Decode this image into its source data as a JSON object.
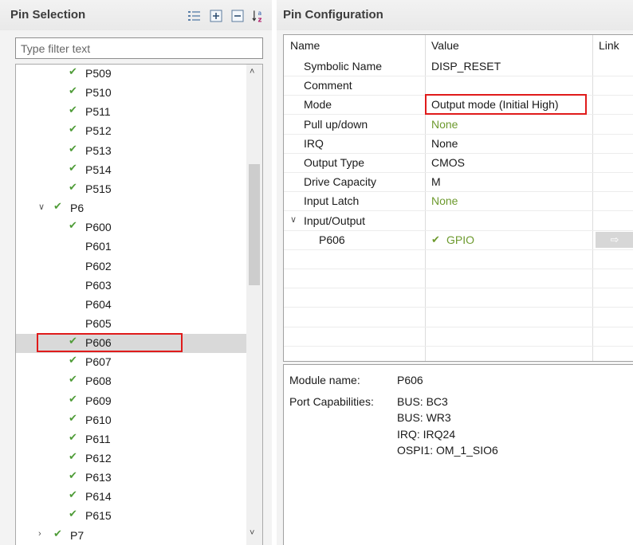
{
  "pin_selection": {
    "title": "Pin Selection",
    "toolbar": [
      {
        "icon": "tree-view-icon"
      },
      {
        "icon": "expand-all-icon"
      },
      {
        "icon": "collapse-all-icon"
      },
      {
        "icon": "sort-az-icon"
      }
    ],
    "filter": {
      "placeholder": "Type filter text",
      "value": ""
    },
    "items": [
      {
        "label": "P509",
        "checked": true,
        "level": 1
      },
      {
        "label": "P510",
        "checked": true,
        "level": 1
      },
      {
        "label": "P511",
        "checked": true,
        "level": 1
      },
      {
        "label": "P512",
        "checked": true,
        "level": 1
      },
      {
        "label": "P513",
        "checked": true,
        "level": 1
      },
      {
        "label": "P514",
        "checked": true,
        "level": 1
      },
      {
        "label": "P515",
        "checked": true,
        "level": 1
      },
      {
        "label": "P6",
        "checked": true,
        "level": 0,
        "expanded": true
      },
      {
        "label": "P600",
        "checked": true,
        "level": 1
      },
      {
        "label": "P601",
        "checked": false,
        "level": 1
      },
      {
        "label": "P602",
        "checked": false,
        "level": 1
      },
      {
        "label": "P603",
        "checked": false,
        "level": 1
      },
      {
        "label": "P604",
        "checked": false,
        "level": 1
      },
      {
        "label": "P605",
        "checked": false,
        "level": 1
      },
      {
        "label": "P606",
        "checked": true,
        "level": 1,
        "selected": true
      },
      {
        "label": "P607",
        "checked": true,
        "level": 1
      },
      {
        "label": "P608",
        "checked": true,
        "level": 1
      },
      {
        "label": "P609",
        "checked": true,
        "level": 1
      },
      {
        "label": "P610",
        "checked": true,
        "level": 1
      },
      {
        "label": "P611",
        "checked": true,
        "level": 1
      },
      {
        "label": "P612",
        "checked": true,
        "level": 1
      },
      {
        "label": "P613",
        "checked": true,
        "level": 1
      },
      {
        "label": "P614",
        "checked": true,
        "level": 1
      },
      {
        "label": "P615",
        "checked": true,
        "level": 1
      },
      {
        "label": "P7",
        "checked": true,
        "level": 0,
        "expanded": false
      }
    ]
  },
  "pin_configuration": {
    "title": "Pin Configuration",
    "columns": [
      "Name",
      "Value",
      "Link"
    ],
    "rows": [
      {
        "name": "Symbolic Name",
        "value": "DISP_RESET"
      },
      {
        "name": "Comment",
        "value": ""
      },
      {
        "name": "Mode",
        "value": "Output mode (Initial High)",
        "highlighted": true
      },
      {
        "name": "Pull up/down",
        "value": "None",
        "style": "default"
      },
      {
        "name": "IRQ",
        "value": "None"
      },
      {
        "name": "Output Type",
        "value": "CMOS"
      },
      {
        "name": "Drive Capacity",
        "value": "M"
      },
      {
        "name": "Input Latch",
        "value": "None",
        "style": "default"
      },
      {
        "name": "Input/Output",
        "value": "",
        "group": true,
        "expanded": true
      },
      {
        "name": "P606",
        "value": "GPIO",
        "child": true,
        "checked": true,
        "link": "arrow-right-icon"
      }
    ],
    "module": {
      "name_label": "Module name:",
      "name_value": "P606",
      "capabilities_label": "Port Capabilities:",
      "capabilities": [
        "BUS: BC3",
        "BUS: WR3",
        "IRQ: IRQ24",
        "OSPI1: OM_1_SIO6"
      ]
    }
  },
  "colors": {
    "check": "#4f9c38",
    "default_value": "#6d9a2e",
    "highlight_box": "#e01b1b",
    "selected_row": "#d9d9d9"
  }
}
